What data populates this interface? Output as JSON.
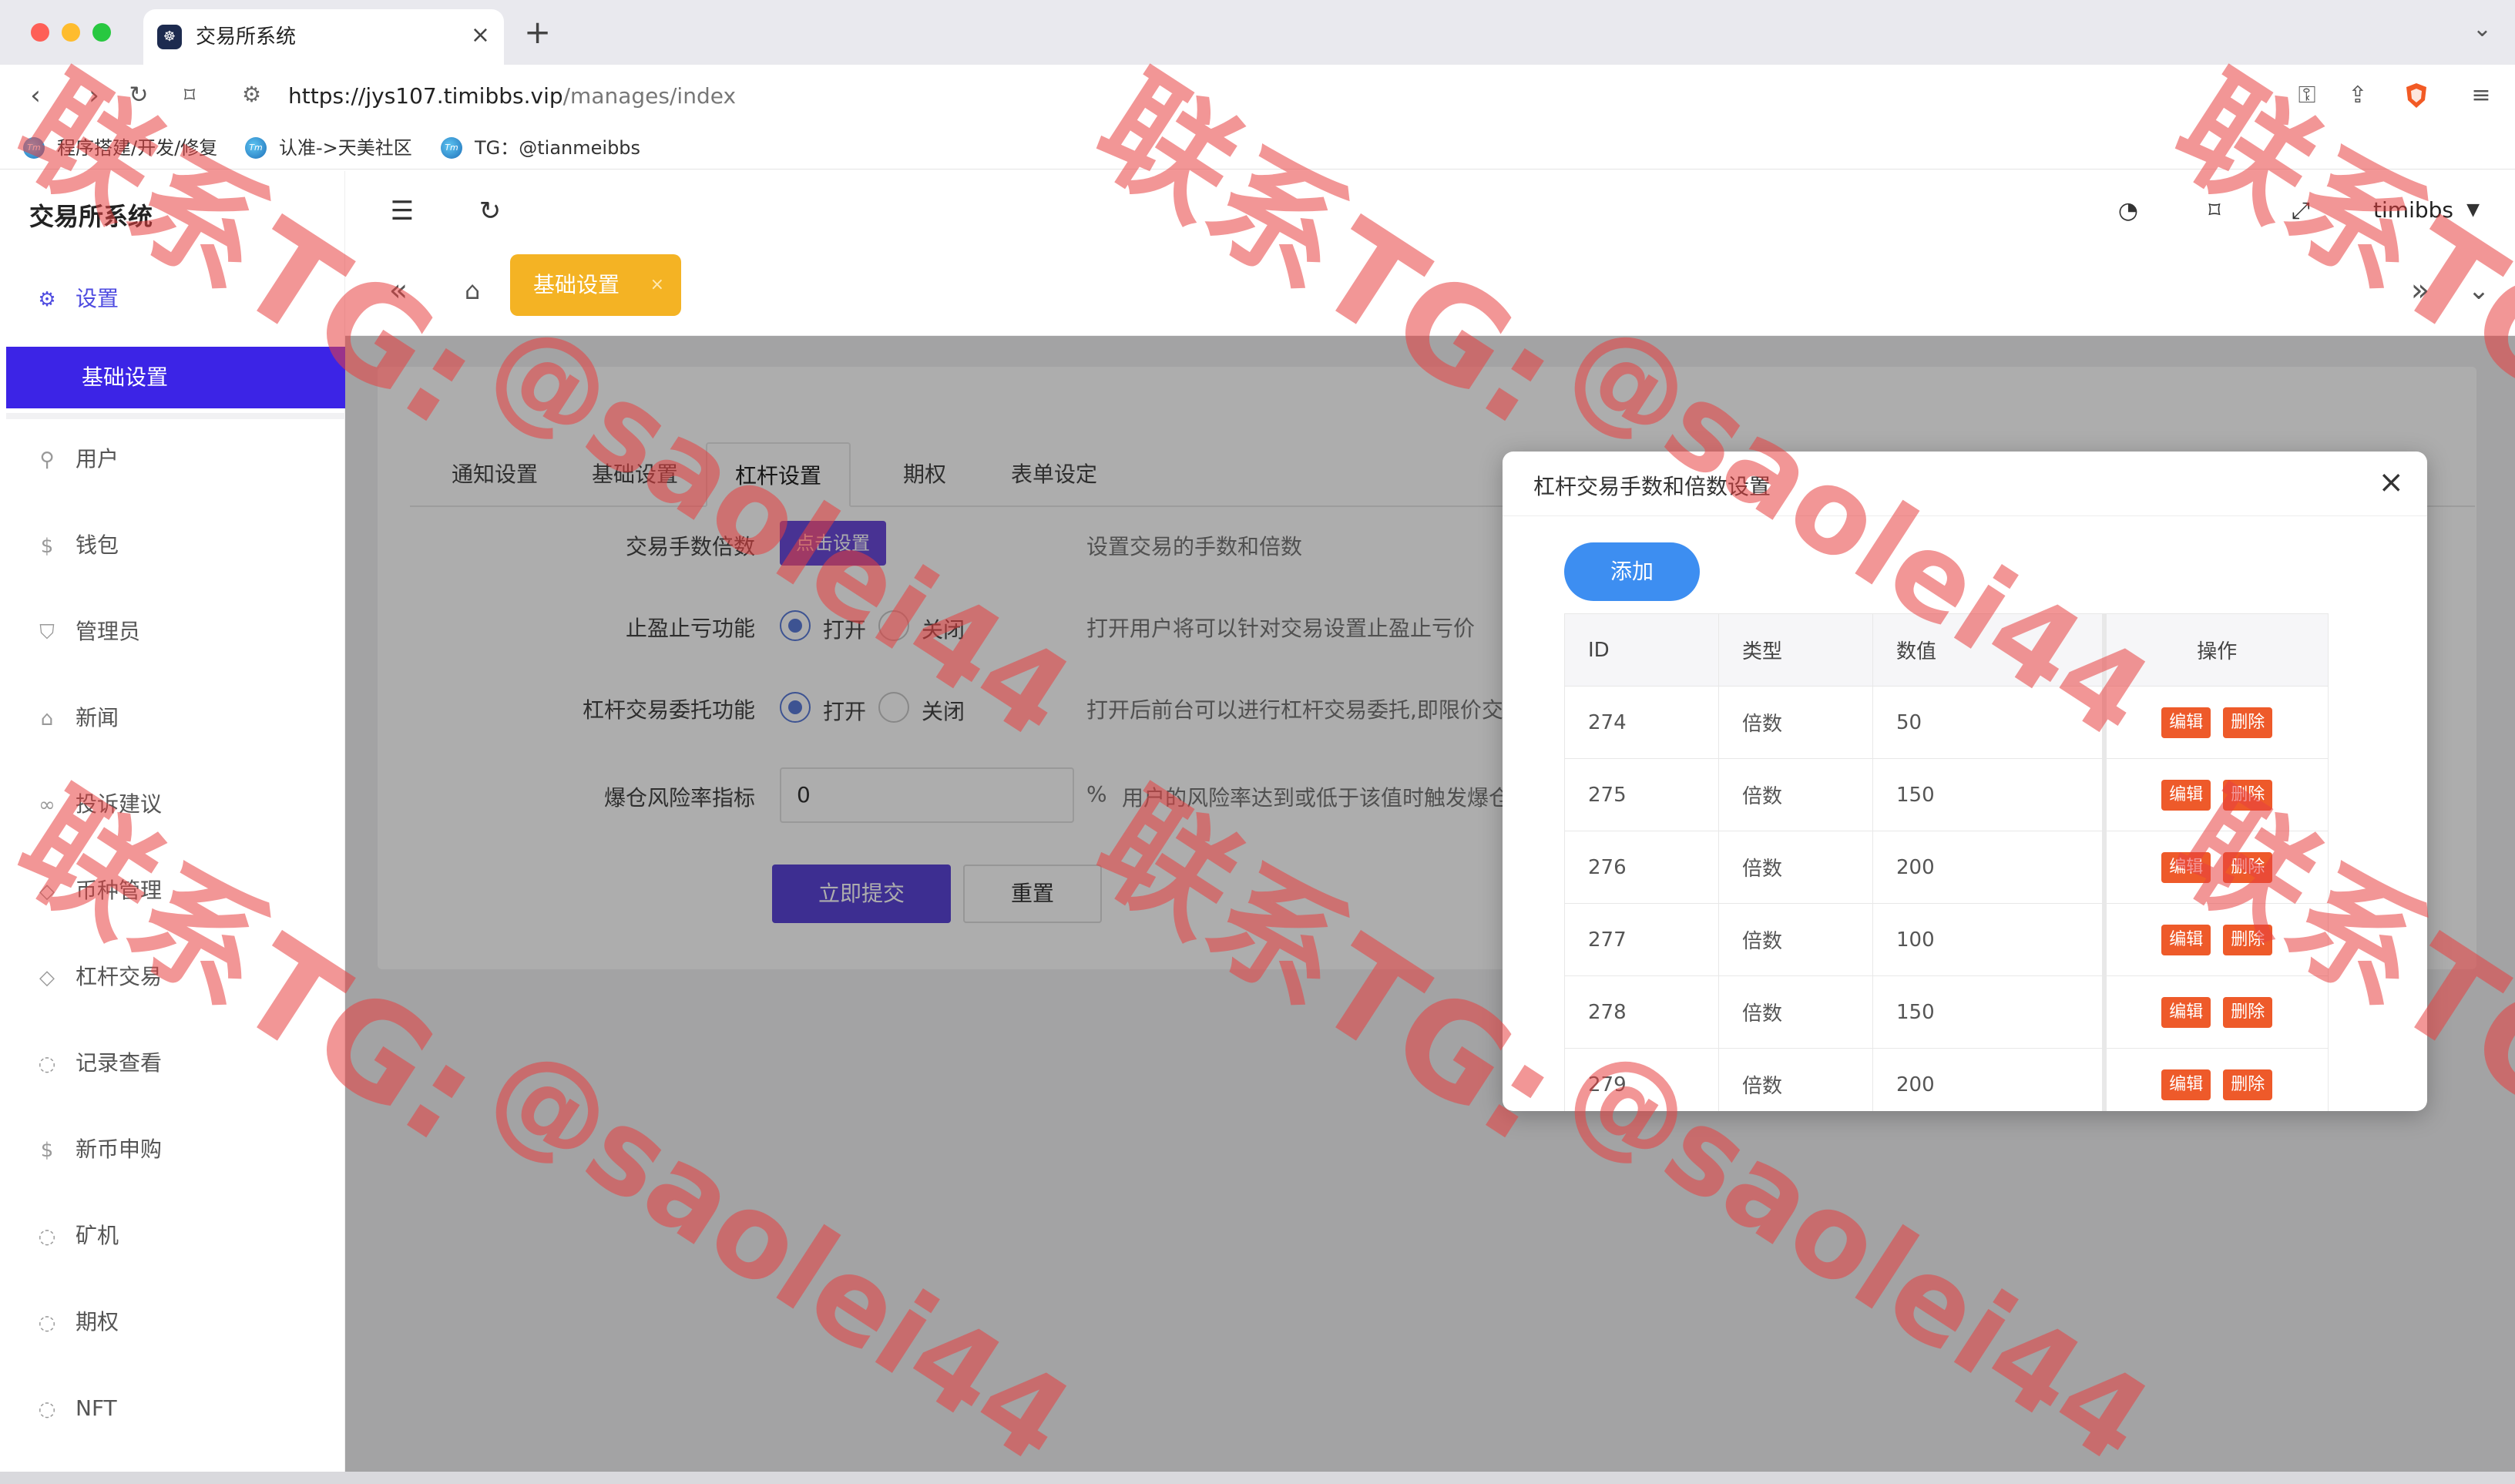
{
  "browser": {
    "tab_title": "交易所系统",
    "new_tab_symbol": "+",
    "url_host": "https://jys107.timibbs.vip",
    "url_path": "/manages/index",
    "bookmarks": [
      "程序搭建/开发/修复",
      "认准->天美社区",
      "TG：@tianmeibbs"
    ]
  },
  "sidebar": {
    "brand": "交易所系统",
    "parent": {
      "label": "设置",
      "icon": "gear-icon"
    },
    "active_item": "基础设置",
    "items": [
      {
        "label": "用户",
        "icon": "user-icon"
      },
      {
        "label": "钱包",
        "icon": "dollar-icon"
      },
      {
        "label": "管理员",
        "icon": "shield-icon"
      },
      {
        "label": "新闻",
        "icon": "tag-icon"
      },
      {
        "label": "投诉建议",
        "icon": "link-icon"
      },
      {
        "label": "币种管理",
        "icon": "diamond-icon"
      },
      {
        "label": "杠杆交易",
        "icon": "diamond-icon"
      },
      {
        "label": "记录查看",
        "icon": "cycle-icon"
      },
      {
        "label": "新币申购",
        "icon": "dollar-icon"
      },
      {
        "label": "矿机",
        "icon": "cycle-icon"
      },
      {
        "label": "期权",
        "icon": "cycle-icon"
      },
      {
        "label": "NFT",
        "icon": "cycle-icon"
      }
    ]
  },
  "topbar": {
    "user": "timibbs"
  },
  "tagbar": {
    "active_tag": "基础设置"
  },
  "form": {
    "tabs": [
      "通知设置",
      "基础设置",
      "杠杆设置",
      "期权",
      "表单设定"
    ],
    "active_tab": "杠杆设置",
    "fee_label": "交易手数倍数",
    "fee_button": "点击设置",
    "fee_hint": "设置交易的手数和倍数",
    "tpsl_label": "止盈止亏功能",
    "tpsl_hint": "打开用户将可以针对交易设置止盈止亏价",
    "entrust_label": "杠杆交易委托功能",
    "entrust_hint": "打开后前台可以进行杠杆交易委托,即限价交易",
    "radio_on": "打开",
    "radio_off": "关闭",
    "risk_label": "爆仓风险率指标",
    "risk_value": "0",
    "risk_unit": "%",
    "risk_hint": "用户的风险率达到或低于该值时触发爆仓",
    "submit": "立即提交",
    "reset": "重置"
  },
  "modal": {
    "title": "杠杆交易手数和倍数设置",
    "add_button": "添加",
    "columns": [
      "ID",
      "类型",
      "数值",
      "操作"
    ],
    "edit_label": "编辑",
    "delete_label": "删除",
    "rows": [
      {
        "id": "274",
        "type": "倍数",
        "value": "50"
      },
      {
        "id": "275",
        "type": "倍数",
        "value": "150"
      },
      {
        "id": "276",
        "type": "倍数",
        "value": "200"
      },
      {
        "id": "277",
        "type": "倍数",
        "value": "100"
      },
      {
        "id": "278",
        "type": "倍数",
        "value": "150"
      },
      {
        "id": "279",
        "type": "倍数",
        "value": "200"
      }
    ]
  },
  "watermark": {
    "line1": "联系TG:",
    "line2": "@saolei44"
  },
  "colors": {
    "accent": "#3c24e6",
    "tag": "#f4b324",
    "danger": "#ee5a2a",
    "primary_blue": "#3d8ef1",
    "watermark": "#e84040"
  }
}
